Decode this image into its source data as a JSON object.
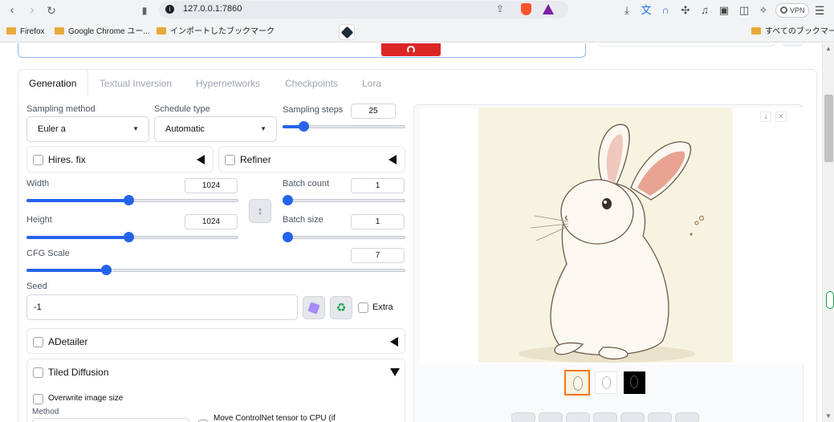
{
  "browser": {
    "url": "127.0.0.1:7860",
    "vpn_label": "VPN",
    "bookmarks": [
      "Firefox",
      "Google Chrome ユー...",
      "インポートしたブックマーク"
    ],
    "all_bookmarks": "すべてのブックマーク",
    "icons": [
      "back-icon",
      "forward-icon",
      "reload-icon",
      "bookmark-icon",
      "info-icon",
      "share-icon",
      "brave-shield-icon",
      "brave-rewards-icon",
      "download-icon",
      "translate-icon",
      "extension-icon",
      "music-icon",
      "sidebar-icon",
      "wallet-icon",
      "leo-icon",
      "menu-icon"
    ]
  },
  "tabs": [
    {
      "label": "Generation",
      "active": true
    },
    {
      "label": "Textual Inversion"
    },
    {
      "label": "Hypernetworks"
    },
    {
      "label": "Checkpoints"
    },
    {
      "label": "Lora"
    }
  ],
  "sampling": {
    "method_label": "Sampling method",
    "method_value": "Euler a",
    "schedule_label": "Schedule type",
    "schedule_value": "Automatic",
    "steps_label": "Sampling steps",
    "steps_value": "25",
    "steps_level": 0.17
  },
  "hires": {
    "label": "Hires. fix"
  },
  "refiner": {
    "label": "Refiner"
  },
  "width": {
    "label": "Width",
    "value": "1024",
    "level": 0.48
  },
  "height": {
    "label": "Height",
    "value": "1024",
    "level": 0.48
  },
  "batch_count": {
    "label": "Batch count",
    "value": "1",
    "level": 0.0
  },
  "batch_size": {
    "label": "Batch size",
    "value": "1",
    "level": 0.0
  },
  "cfg": {
    "label": "CFG Scale",
    "value": "7",
    "level": 0.21
  },
  "seed": {
    "label": "Seed",
    "value": "-1",
    "extra_label": "Extra"
  },
  "adetailer": {
    "label": "ADetailer"
  },
  "tiled": {
    "label": "Tiled Diffusion",
    "overwrite_label": "Overwrite image size",
    "method_label": "Method",
    "controlnet_label": "Move ControlNet tensor to CPU (if"
  },
  "swap_icon": "↕",
  "colors": {
    "accent": "#2563eb",
    "generate": "#dc2626",
    "thumb_selected": "#f97316"
  }
}
